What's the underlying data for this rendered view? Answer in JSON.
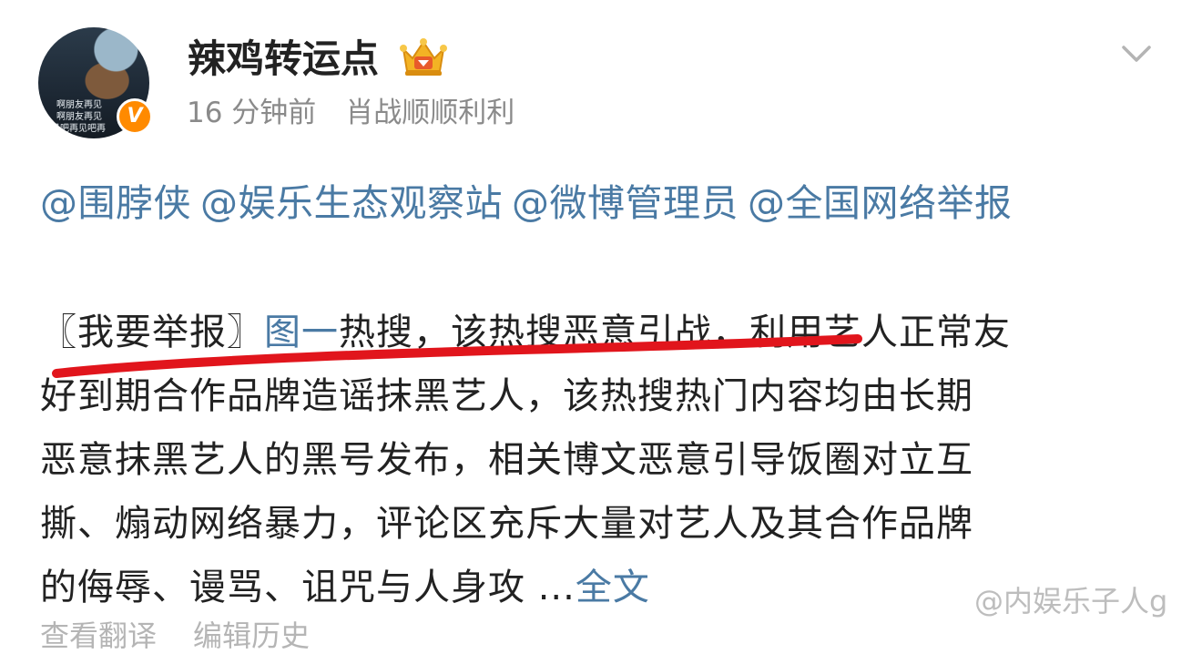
{
  "post": {
    "avatar": {
      "caption_lines": [
        "啊朋友再见",
        "啊朋友再见",
        "见吧再见吧再"
      ]
    },
    "verified_badge": "V",
    "username": "辣鸡转运点",
    "timestamp": "16 分钟前",
    "source": "肖战顺顺利利",
    "mentions": [
      "@围脖侠",
      "@娱乐生态观察站",
      "@微博管理员",
      "@全国网络举报"
    ],
    "body": {
      "line1_prefix": "〖我要举报〗",
      "line1_link": "图一",
      "line1_rest": "热搜，该热搜恶意引战，利用艺人正常友",
      "line2": "好到期合作品牌造谣抹黑艺人，该热搜热门内容均由长期",
      "line3": "恶意抹黑艺人的黑号发布，相关博文恶意引导饭圈对立互",
      "line4": "撕、煽动网络暴力，评论区充斥大量对艺人及其合作品牌",
      "line5": "的侮辱、谩骂、诅咒与人身攻 ...",
      "full_text_link": "全文"
    },
    "footer": {
      "translate": "查看翻译",
      "edit_history": "编辑历史"
    }
  },
  "watermark": "@内娱乐子人g",
  "colors": {
    "link": "#4a7aa4",
    "text": "#222222",
    "meta": "#8a8a8a",
    "badge": "#ff8a00",
    "annotation": "#e1151c"
  },
  "icons": {
    "crown": "crown-icon",
    "chevron": "chevron-down-icon"
  }
}
